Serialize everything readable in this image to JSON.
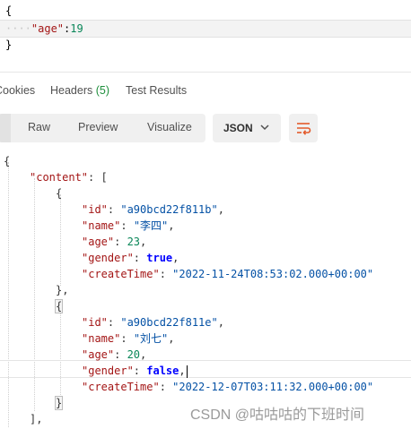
{
  "request_body": {
    "line1": "{",
    "line2_key": "\"age\"",
    "line2_colon": ":",
    "line2_value": "19",
    "line3": "}"
  },
  "response_tabs": {
    "cookies": "Cookies",
    "headers": "Headers",
    "headers_count": "(5)",
    "test_results": "Test Results"
  },
  "toolbar": {
    "raw": "Raw",
    "preview": "Preview",
    "visualize": "Visualize",
    "format": "JSON"
  },
  "response": {
    "open_root": "{",
    "content_key": "\"content\"",
    "open_arr": ": [",
    "records": [
      {
        "id_key": "\"id\"",
        "id_val": "\"a90bcd22f811b\"",
        "name_key": "\"name\"",
        "name_val": "\"李四\"",
        "age_key": "\"age\"",
        "age_val": "23",
        "gender_key": "\"gender\"",
        "gender_val": "true",
        "ct_key": "\"createTime\"",
        "ct_val": "\"2022-11-24T08:53:02.000+00:00\""
      },
      {
        "id_key": "\"id\"",
        "id_val": "\"a90bcd22f811e\"",
        "name_key": "\"name\"",
        "name_val": "\"刘七\"",
        "age_key": "\"age\"",
        "age_val": "20",
        "gender_key": "\"gender\"",
        "gender_val": "false",
        "ct_key": "\"createTime\"",
        "ct_val": "\"2022-12-07T03:11:32.000+00:00\""
      }
    ],
    "close_arr": "],"
  },
  "watermark": "CSDN @咕咕咕的下班时间"
}
